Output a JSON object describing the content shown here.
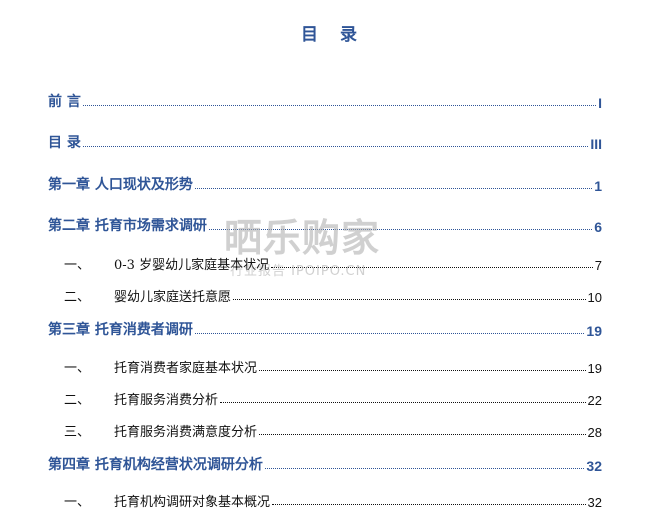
{
  "title": "目 录",
  "entries": [
    {
      "level": "chapter",
      "label": "前 言",
      "page": "I"
    },
    {
      "level": "chapter",
      "label": "目 录",
      "page": "III"
    },
    {
      "level": "chapter",
      "label": "第一章  人口现状及形势",
      "page": "1"
    },
    {
      "level": "chapter",
      "label": "第二章  托育市场需求调研",
      "page": "6"
    },
    {
      "level": "section",
      "num": "一、",
      "label": "0-3 岁婴幼儿家庭基本状况",
      "page": "7"
    },
    {
      "level": "section",
      "num": "二、",
      "label": "婴幼儿家庭送托意愿",
      "page": "10"
    },
    {
      "level": "chapter",
      "label": "第三章  托育消费者调研",
      "page": "19"
    },
    {
      "level": "section",
      "num": "一、",
      "label": "托育消费者家庭基本状况",
      "page": "19"
    },
    {
      "level": "section",
      "num": "二、",
      "label": "托育服务消费分析",
      "page": "22"
    },
    {
      "level": "section",
      "num": "三、",
      "label": "托育服务消费满意度分析",
      "page": "28"
    },
    {
      "level": "chapter",
      "label": "第四章  托育机构经营状况调研分析",
      "page": "32"
    },
    {
      "level": "section",
      "num": "一、",
      "label": "托育机构调研对象基本概况",
      "page": "32"
    }
  ],
  "watermark": {
    "main": "晒乐购家",
    "sub": "行业报告 IPOIPO.CN"
  }
}
